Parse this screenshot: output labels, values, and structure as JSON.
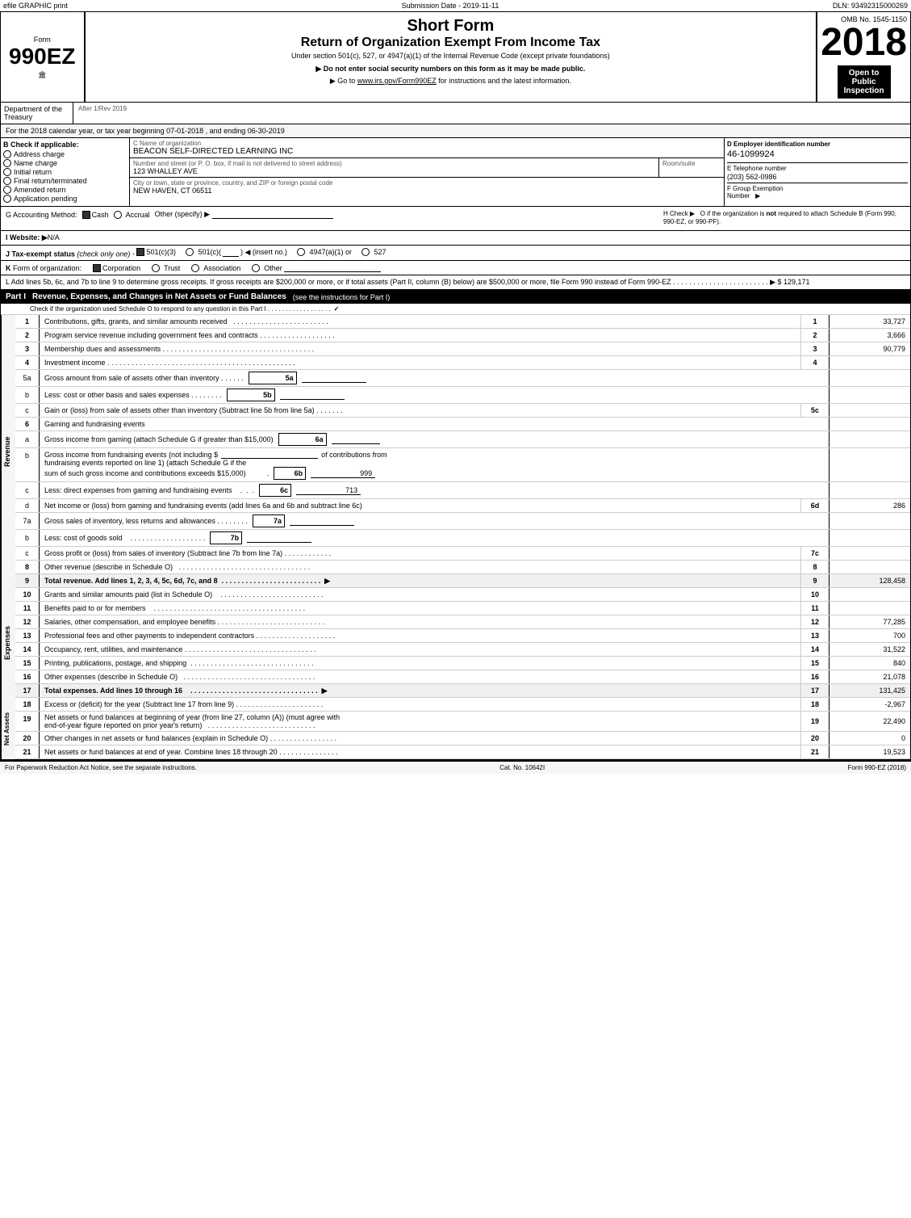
{
  "topBar": {
    "left": "efile GRAPHIC print",
    "middle": "Submission Date - 2019-11-11",
    "right": "DLN: 93492315000269"
  },
  "header": {
    "formLabel": "Form",
    "formNumber": "990EZ",
    "shortForm": "Short Form",
    "returnTitle": "Return of Organization Exempt From Income Tax",
    "subtitle": "Under section 501(c), 527, or 4947(a)(1) of the Internal Revenue Code (except private foundations)",
    "notice1": "▶ Do not enter social security numbers on this form as it may be made public.",
    "notice2": "▶ Go to www.irs.gov/Form990EZ for instructions and the latest information.",
    "year": "2018",
    "openTo": "Open to\nPublic\nInspection",
    "ombNo": "OMB No. 1545-1150"
  },
  "deptRow": {
    "dept": "Department of the\nTreasury",
    "afterRev": "After 1/Rev 2019"
  },
  "taxYearRow": "For the 2018 calendar year, or tax year beginning 07-01-2018        , and ending 06-30-2019",
  "checkIfApplicable": {
    "label": "B Check if applicable:",
    "items": [
      {
        "id": "address-change",
        "label": "Address charge",
        "checked": false
      },
      {
        "id": "name-change",
        "label": "Name charge",
        "checked": false
      },
      {
        "id": "initial-return",
        "label": "Initial return",
        "checked": false
      },
      {
        "id": "final-return",
        "label": "Final return/terminated",
        "checked": false
      },
      {
        "id": "amended-return",
        "label": "Amended return",
        "checked": false
      },
      {
        "id": "app-pending",
        "label": "Application pending",
        "checked": false
      }
    ]
  },
  "orgInfo": {
    "nameLabel": "C Name of organization",
    "nameValue": "BEACON SELF-DIRECTED LEARNING INC",
    "addressLabel": "Number and street (or P. O. box, if mail is not delivered to street address)",
    "addressValue": "123 WHALLEY AVE",
    "roomLabel": "Room/suite",
    "roomValue": "",
    "cityLabel": "City or town, state or province, country, and ZIP or foreign postal code",
    "cityValue": "NEW HAVEN, CT  06511",
    "einLabel": "D Employer identification number",
    "einValue": "46-1099924",
    "phoneLabel": "E Telephone number",
    "phoneValue": "(203) 562-0986",
    "groupExLabel": "F Group Exemption\nNumber",
    "groupExValue": "▶"
  },
  "accountingMethod": {
    "label": "G Accounting Method:",
    "cashChecked": true,
    "cashLabel": "Cash",
    "accrualChecked": false,
    "accrualLabel": "Accrual",
    "otherLabel": "Other (specify) ▶",
    "hCheck": "H Check ▶  O if the organization is not required to attach Schedule B (Form 990, 990-EZ, or 990-PF)."
  },
  "website": {
    "label": "I Website: ▶",
    "value": "N/A"
  },
  "taxExempt": {
    "label": "J Tax-exempt status",
    "checkOnly": "(check only one) -",
    "options": [
      {
        "label": "501(c)(3)",
        "checked": true
      },
      {
        "label": "501(c)(  )",
        "checked": false,
        "insertNo": "(insert no.)"
      },
      {
        "label": "4947(a)(1) or",
        "checked": false
      },
      {
        "label": "527",
        "checked": false
      }
    ]
  },
  "formOrg": {
    "label": "K Form of organization:",
    "options": [
      {
        "label": "Corporation",
        "checked": true
      },
      {
        "label": "Trust",
        "checked": false
      },
      {
        "label": "Association",
        "checked": false
      },
      {
        "label": "Other",
        "checked": false,
        "field": true
      }
    ]
  },
  "lineL": "L Add lines 5b, 6c, and 7b to line 9 to determine gross receipts. If gross receipts are $200,000 or more, or if total assets (Part II, column (B) below) are $500,000 or more, file Form 990 instead of Form 990-EZ  . . . . . . . . . . . . . . . . . . . . . . . . ▶ $ 129,171",
  "partI": {
    "label": "Part I",
    "title": "Revenue, Expenses, and Changes in Net Assets or Fund Balances",
    "titleNote": "(see the instructions for Part I)",
    "checkInstruction": "Check if the organization used Schedule O to respond to any question in this Part I  . . . . . . . . . . . . . . . . . .",
    "checkValue": "✓",
    "rows": [
      {
        "num": "1",
        "desc": "Contributions, gifts, grants, and similar amounts received . . . . . . . . . . . . . . . . . . . . . . . .",
        "lineNum": "1",
        "value": "33,727"
      },
      {
        "num": "2",
        "desc": "Program service revenue including government fees and contracts . . . . . . . . . . . . . . . . . . .",
        "lineNum": "2",
        "value": "3,666"
      },
      {
        "num": "3",
        "desc": "Membership dues and assessments . . . . . . . . . . . . . . . . . . . . . . . . . . . . . . . . . . . . . .",
        "lineNum": "3",
        "value": "90,779"
      },
      {
        "num": "4",
        "desc": "Investment income . . . . . . . . . . . . . . . . . . . . . . . . . . . . . . . . . . . . . . . . . . . . . . .",
        "lineNum": "4",
        "value": ""
      }
    ],
    "row5": {
      "a": {
        "alpha": "5a",
        "desc": "Gross amount from sale of assets other than inventory . . . . . .",
        "boxLabel": "5a",
        "boxValue": ""
      },
      "b": {
        "alpha": "b",
        "desc": "Less: cost or other basis and sales expenses . . . . . . . .",
        "boxLabel": "5b",
        "boxValue": ""
      },
      "c": {
        "alpha": "c",
        "desc": "Gain or (loss) from sale of assets other than inventory (Subtract line 5b from line 5a)  . . . . . . .",
        "lineNum": "5c",
        "value": ""
      }
    },
    "row6Header": {
      "num": "6",
      "desc": "Gaming and fundraising events"
    },
    "row6a": {
      "alpha": "a",
      "desc": "Gross income from gaming (attach Schedule G if greater than $15,000)",
      "boxLabel": "6a",
      "boxValue": ""
    },
    "row6b": {
      "alpha": "b",
      "descLines": [
        "Gross income from fundraising events (not including $                        of contributions from",
        "fundraising events reported on line 1) (attach Schedule G if the",
        "sum of such gross income and contributions exceeds $15,000)"
      ],
      "boxLabel": "6b",
      "boxValue": "999"
    },
    "row6c": {
      "alpha": "c",
      "desc": "Less: direct expenses from gaming and fundraising events",
      "boxLabel": "6c",
      "boxValue": "713"
    },
    "row6d": {
      "alpha": "d",
      "desc": "Net income or (loss) from gaming and fundraising events (add lines 6a and 6b and subtract line 6c)",
      "lineNum": "6d",
      "value": "286"
    },
    "row7a": {
      "alpha": "7a",
      "desc": "Gross sales of inventory, less returns and allowances . . . . . . . .",
      "boxLabel": "7a",
      "boxValue": ""
    },
    "row7b": {
      "alpha": "b",
      "desc": "Less: cost of goods sold   . . . . . . . . . . . . . . . . . . .",
      "boxLabel": "7b",
      "boxValue": ""
    },
    "row7c": {
      "alpha": "c",
      "desc": "Gross profit or (loss) from sales of inventory (Subtract line 7b from line 7a) . . . . . . . . . . . .",
      "lineNum": "7c",
      "value": ""
    },
    "row8": {
      "num": "8",
      "desc": "Other revenue (describe in Schedule O)  . . . . . . . . . . . . . . . . . . . . . . . . . . . . . . . . .",
      "lineNum": "8",
      "value": ""
    },
    "row9": {
      "num": "9",
      "desc": "Total revenue. Add lines 1, 2, 3, 4, 5c, 6d, 7c, and 8  . . . . . . . . . . . . . . . . . . . . . . . .",
      "lineNum": "9",
      "value": "128,458",
      "bold": true,
      "arrow": true
    }
  },
  "expenses": {
    "rows": [
      {
        "num": "10",
        "desc": "Grants and similar amounts paid (list in Schedule O)  . . . . . . . . . . . . . . . . . . . . . . . . . .",
        "lineNum": "10",
        "value": ""
      },
      {
        "num": "11",
        "desc": "Benefits paid to or for members   . . . . . . . . . . . . . . . . . . . . . . . . . . . . . . . . . . . . . .",
        "lineNum": "11",
        "value": ""
      },
      {
        "num": "12",
        "desc": "Salaries, other compensation, and employee benefits . . . . . . . . . . . . . . . . . . . . . . . . . . .",
        "lineNum": "12",
        "value": "77,285"
      },
      {
        "num": "13",
        "desc": "Professional fees and other payments to independent contractors . . . . . . . . . . . . . . . . . . . .",
        "lineNum": "13",
        "value": "700"
      },
      {
        "num": "14",
        "desc": "Occupancy, rent, utilities, and maintenance . . . . . . . . . . . . . . . . . . . . . . . . . . . . . . . . .",
        "lineNum": "14",
        "value": "31,522"
      },
      {
        "num": "15",
        "desc": "Printing, publications, postage, and shipping  . . . . . . . . . . . . . . . . . . . . . . . . . . . . . . .",
        "lineNum": "15",
        "value": "840"
      },
      {
        "num": "16",
        "desc": "Other expenses (describe in Schedule O)  . . . . . . . . . . . . . . . . . . . . . . . . . . . . . . . . .",
        "lineNum": "16",
        "value": "21,078"
      },
      {
        "num": "17",
        "desc": "Total expenses. Add lines 10 through 16   . . . . . . . . . . . . . . . . . . . . . . . . . . . . . . . .",
        "lineNum": "17",
        "value": "131,425",
        "bold": true,
        "arrow": true
      }
    ]
  },
  "netAssets": {
    "rows": [
      {
        "num": "18",
        "desc": "Excess or (deficit) for the year (Subtract line 17 from line 9) . . . . . . . . . . . . . . . . . . . . . .",
        "lineNum": "18",
        "value": "-2,967"
      },
      {
        "num": "19",
        "descLines": [
          "Net assets or fund balances at beginning of year (from line 27, column (A)) (must agree with",
          "end-of-year figure reported on prior year's return)  . . . . . . . . . . . . . . . . . . . . . . . . . . ."
        ],
        "lineNum": "19",
        "value": "22,490"
      },
      {
        "num": "20",
        "desc": "Other changes in net assets or fund balances (explain in Schedule O)  . . . . . . . . . . . . . . . . .",
        "lineNum": "20",
        "value": "0"
      },
      {
        "num": "21",
        "desc": "Net assets or fund balances at end of year. Combine lines 18 through 20  . . . . . . . . . . . . . . .",
        "lineNum": "21",
        "value": "19,523"
      }
    ]
  },
  "footer": {
    "left": "For Paperwork Reduction Act Notice, see the separate instructions.",
    "middle": "Cat. No. 10642I",
    "right": "Form 990-EZ (2018)"
  }
}
